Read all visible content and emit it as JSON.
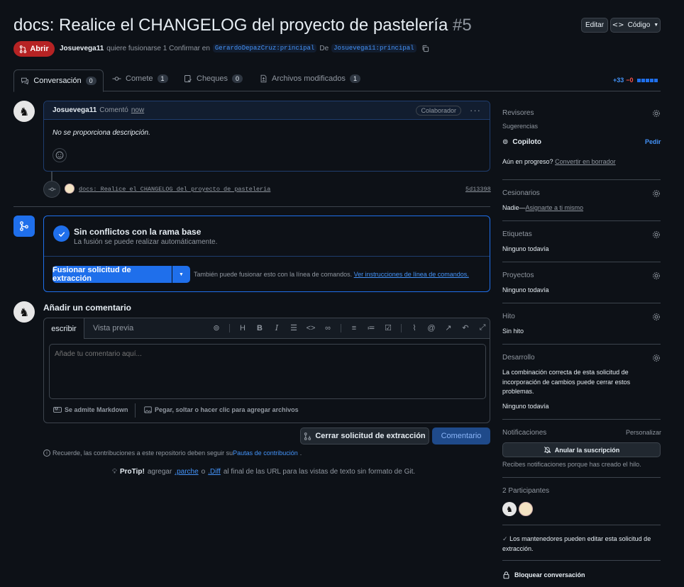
{
  "header": {
    "title": "docs: Realice el CHANGELOG del proyecto de pastelería",
    "number": "#5",
    "edit_label": "Editar",
    "code_label": "Código",
    "state_label": "Abrir",
    "author": "Josuevega11",
    "merge_text": "quiere fusionarse 1 Confirmar en",
    "base_branch": "GerardoDepazCruz:principal",
    "from_label": "De",
    "head_branch": "Josuevega11:principal"
  },
  "tabs": [
    {
      "label": "Conversación",
      "count": "0"
    },
    {
      "label": "Comete",
      "count": "1"
    },
    {
      "label": "Cheques",
      "count": "0"
    },
    {
      "label": "Archivos modificados",
      "count": "1"
    }
  ],
  "diffstat": {
    "added": "+33",
    "removed": "−0"
  },
  "comment": {
    "author": "Josuevega11",
    "verb": "Comentó",
    "time": "now",
    "badge": "Colaborador",
    "body": "No se proporciona descripción."
  },
  "commit": {
    "message": "docs: Realice el CHANGELOG del proyecto de pasteleria",
    "sha": "5d13398"
  },
  "merge": {
    "title": "Sin conflictos con la rama base",
    "subtitle": "La fusión se puede realizar automáticamente.",
    "button": "Fusionar solicitud de extracción",
    "hint": "También puede fusionar esto con la línea de comandos.",
    "hint_link": "Ver instrucciones de línea de comandos."
  },
  "composer": {
    "heading": "Añadir un comentario",
    "tab_write": "escribir",
    "tab_preview": "Vista previa",
    "placeholder": "Añade tu comentario aquí...",
    "markdown": "Se admite Markdown",
    "attach": "Pegar, soltar o hacer clic para agregar archivos",
    "close_button": "Cerrar solicitud de extracción",
    "comment_button": "Comentario"
  },
  "footer": {
    "reminder": "Recuerde, las contribuciones a este repositorio deben seguir su",
    "reminder_link": "Pautas de contribución",
    "protip_label": "ProTip!",
    "protip_a": "agregar",
    "protip_patch": ".parche",
    "protip_o": "o",
    "protip_diff": ".Diff",
    "protip_b": "al final de las URL para las vistas de texto sin formato de Git."
  },
  "sidebar": {
    "reviewers": {
      "title": "Revisores",
      "suggestions": "Sugerencias",
      "copilot": "Copiloto",
      "request": "Pedir",
      "progress": "Aún en progreso?",
      "draft_link": "Convertir en borrador"
    },
    "assignees": {
      "title": "Cesionarios",
      "none": "Nadie—",
      "self_link": "Asignarte a ti mismo"
    },
    "labels": {
      "title": "Etiquetas",
      "value": "Ninguno todavía"
    },
    "projects": {
      "title": "Proyectos",
      "value": "Ninguno todavía"
    },
    "milestone": {
      "title": "Hito",
      "value": "Sin hito"
    },
    "development": {
      "title": "Desarrollo",
      "text": "La combinación correcta de esta solicitud de incorporación de cambios puede cerrar estos problemas.",
      "value": "Ninguno todavía"
    },
    "notifications": {
      "title": "Notificaciones",
      "customize": "Personalizar",
      "button": "Anular la suscripción",
      "note": "Recibes notificaciones porque has creado el hilo."
    },
    "participants": {
      "title": "2 Participantes"
    },
    "maintainers": "Los mantenedores pueden editar esta solicitud de extracción.",
    "lock": "Bloquear conversación"
  },
  "colors": {
    "accent": "#4493f8",
    "open": "#b62324",
    "merge_blue": "#1f6feb",
    "added": "#3fb950"
  }
}
